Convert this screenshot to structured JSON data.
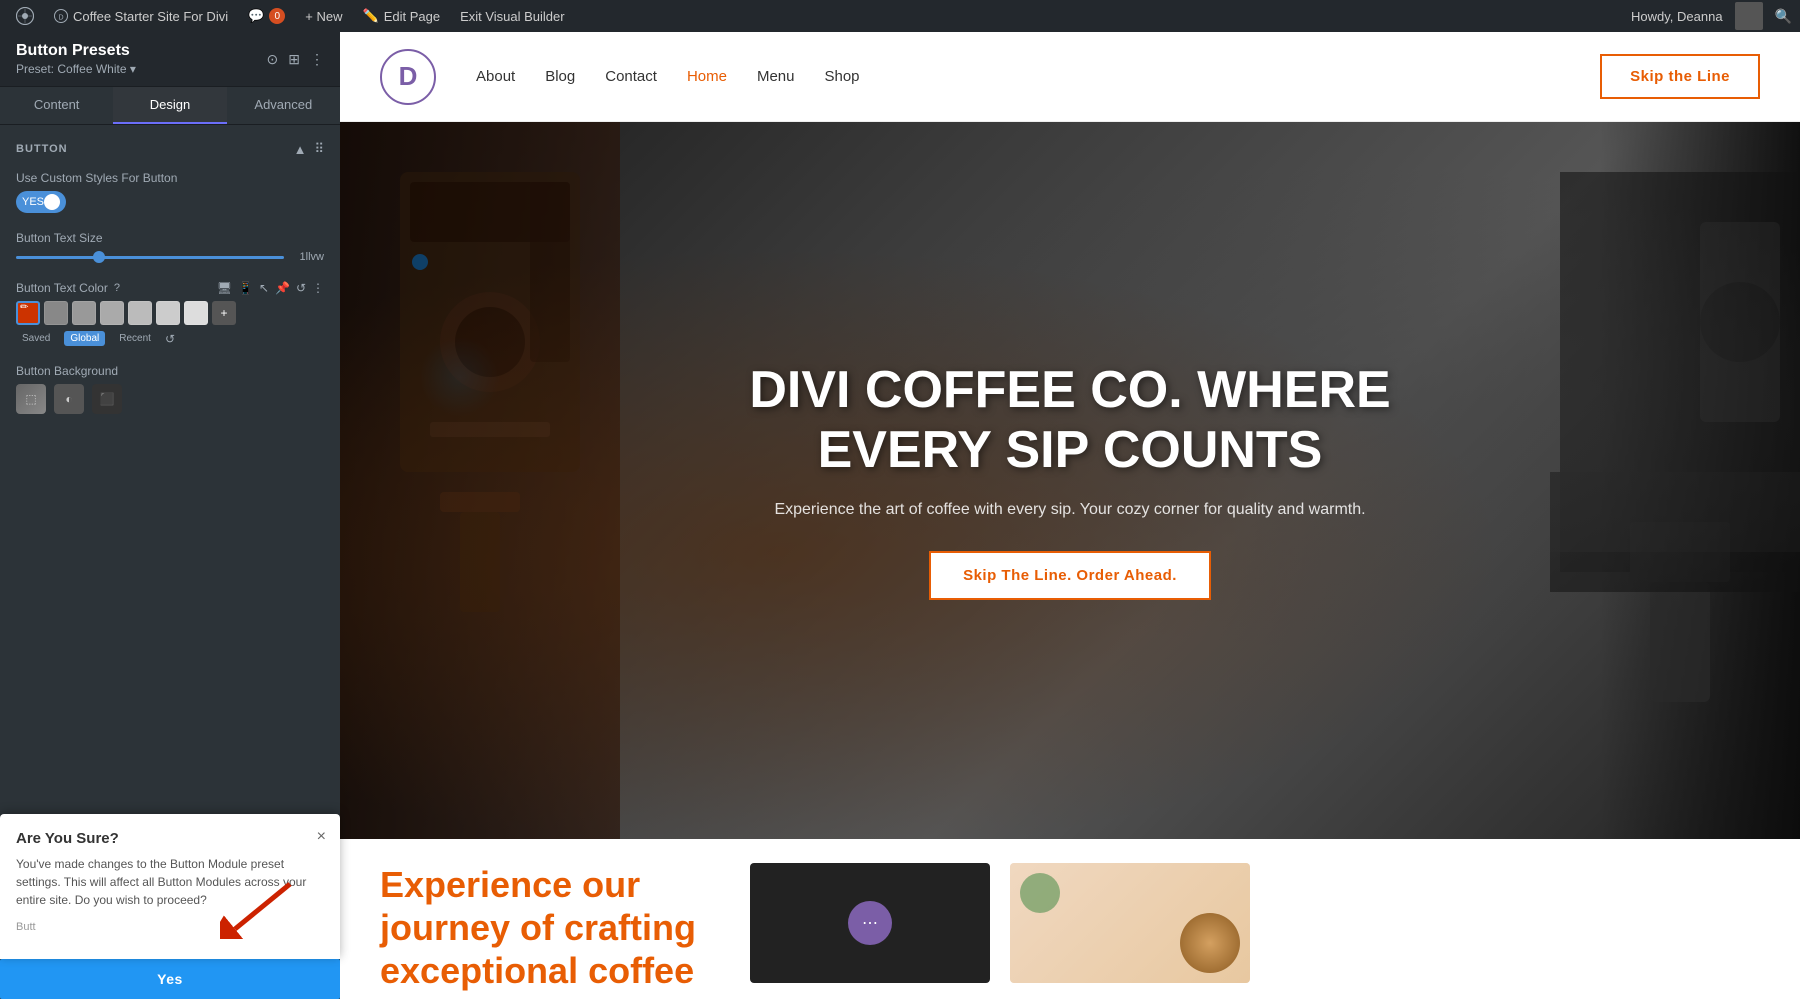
{
  "admin_bar": {
    "wp_icon": "⊞",
    "site_name": "Coffee Starter Site For Divi",
    "comment_icon": "💬",
    "comment_count": "0",
    "new_label": "+ New",
    "edit_page_label": "Edit Page",
    "exit_builder_label": "Exit Visual Builder",
    "howdy": "Howdy, Deanna",
    "search_icon": "🔍"
  },
  "left_panel": {
    "title": "Button Presets",
    "subtitle": "Preset: Coffee White ▾",
    "icon_focus": "⊙",
    "icon_columns": "⊞",
    "icon_more": "⋮",
    "tabs": [
      {
        "id": "content",
        "label": "Content"
      },
      {
        "id": "design",
        "label": "Design"
      },
      {
        "id": "advanced",
        "label": "Advanced"
      }
    ],
    "active_tab": "design",
    "section_button": {
      "title": "Button",
      "collapse_icon": "▲",
      "drag_icon": "⠿"
    },
    "use_custom_styles": {
      "label": "Use Custom Styles For Button",
      "value": "YES"
    },
    "button_text_size": {
      "label": "Button Text Size",
      "value": "",
      "placeholder": "1llvw"
    },
    "button_text_color": {
      "label": "Button Text Color",
      "question_icon": "?",
      "icons": [
        "desktop",
        "mobile",
        "arrow",
        "pin",
        "undo",
        "more"
      ],
      "swatches": [
        {
          "color": "#cc3300",
          "is_edit": true
        },
        {
          "color": "#888888"
        },
        {
          "color": "#999999"
        },
        {
          "color": "#aaaaaa"
        },
        {
          "color": "#bbbbbb"
        },
        {
          "color": "#cccccc"
        },
        {
          "color": "#dddddd"
        },
        {
          "color": "#eeeeee",
          "is_add": true
        }
      ],
      "modes": [
        "Saved",
        "Global",
        "Recent"
      ],
      "active_mode": "Global"
    },
    "button_background": {
      "label": "Button Background",
      "items": [
        "gradient1",
        "gradient2",
        "solid"
      ]
    }
  },
  "dialog": {
    "title": "Are You Sure?",
    "text": "You've made changes to the Button Module preset settings. This will affect all Button Modules across your entire site. Do you wish to proceed?",
    "close_icon": "×",
    "yes_label": "Yes",
    "button_label_bottom": "Butt"
  },
  "site": {
    "nav": {
      "logo_letter": "D",
      "links": [
        "About",
        "Blog",
        "Contact",
        "Home",
        "Menu",
        "Shop"
      ],
      "active_link": "Home",
      "cta_label": "Skip the Line"
    },
    "hero": {
      "title": "DIVI COFFEE CO. WHERE EVERY SIP COUNTS",
      "subtitle": "Experience the art of coffee with every sip. Your cozy corner for quality and warmth.",
      "cta_label": "Skip The Line. Order Ahead."
    },
    "bottom": {
      "experience_text": "Experience our journey of crafting exceptional coffee"
    }
  }
}
